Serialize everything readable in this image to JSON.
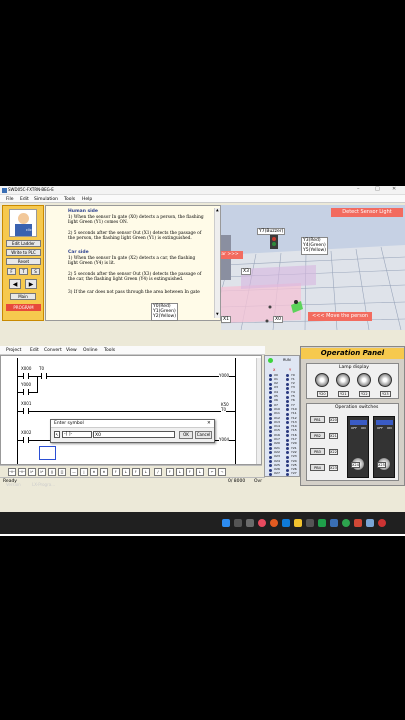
{
  "window": {
    "title": "SWD05C-FXTRN-BEG-E"
  },
  "menu": [
    "File",
    "Edit",
    "Simulation",
    "Tools",
    "Help"
  ],
  "left_panel": {
    "edit_ladder": "Edit Ladder",
    "write_plc": "Write to PLC",
    "reset": "Reset",
    "keys": [
      "F",
      "T",
      "S"
    ],
    "main": "Main",
    "program": "PROGRAM"
  },
  "help": {
    "human_title": "Human side",
    "human_1": "1) When the sensor In gate (X0) detects a person, the flashing light Green (Y1) comes ON.",
    "human_2": "2) 5 seconds after the sensor Out (X1) detects the passage of the person, the flashing light Green (Y1) is extinguished.",
    "car_title": "Car side",
    "car_1": "1) When the sensor In gate (X2) detects a car, the flashing light Green (Y4) is lit.",
    "car_2": "2) 5 seconds after the sensor Out (X3) detects the passage of the car, the flashing light Green (Y4) is extinguished.",
    "car_3": "3) If the car does not pass through the area between In gate"
  },
  "scene": {
    "detect_sensor_light": "Detect Sensor Light",
    "buzzer": "Y7(Buzzer)",
    "car_lights": [
      "Y3(Red)",
      "Y4(Green)",
      "Y5(Yellow)"
    ],
    "person_lights": [
      "Y0(Red)",
      "Y1(Green)",
      "Y2(Yellow)"
    ],
    "nav_button": "ar >>>",
    "x3": "X3",
    "x1": "X1",
    "x0": "X0",
    "move_person": "<<< Move the person"
  },
  "ladder_menu": [
    "Project",
    "Edit",
    "Convert",
    "View",
    "Online",
    "Tools"
  ],
  "ladder": {
    "rungs": [
      {
        "step": "X000",
        "contact": "T0",
        "coil": "Y000"
      },
      {
        "step": "Y000",
        "contact": "",
        "coil": ""
      },
      {
        "step": "X001",
        "contact": "",
        "coil": "K50",
        "coil2": "T0"
      },
      {
        "step": "X002",
        "contact": "",
        "coil": "Y004"
      }
    ]
  },
  "dialog": {
    "title": "Enter symbol",
    "type": "-[ ]-",
    "value": "X0",
    "ok": "OK",
    "cancel": "Cancel"
  },
  "status": {
    "ready": "Ready",
    "steps": "0/ 8000",
    "mode": "Ovr",
    "version": "Version",
    "program": "LX-Progra..."
  },
  "io": {
    "run": "RUN",
    "x_header": "X",
    "y_header": "Y",
    "x_labels": [
      "X0",
      "X1",
      "X2",
      "X3",
      "X4",
      "X5",
      "X6",
      "X7",
      "X10",
      "X11",
      "X12",
      "X13",
      "X14",
      "X15",
      "X16",
      "X17",
      "X20",
      "X21",
      "X22",
      "X23",
      "X24",
      "X25",
      "X26",
      "X27"
    ],
    "y_labels": [
      "Y0",
      "Y1",
      "Y2",
      "Y3",
      "Y4",
      "Y5",
      "Y6",
      "Y7",
      "Y10",
      "Y11",
      "Y12",
      "Y13",
      "Y14",
      "Y15",
      "Y16",
      "Y17",
      "Y20",
      "Y21",
      "Y22",
      "Y23",
      "Y24",
      "Y25",
      "Y26",
      "Y27"
    ]
  },
  "op_panel": {
    "title": "Operation Panel",
    "lamp_display": "Lamp display",
    "lamps": [
      "Y20",
      "Y21",
      "Y22",
      "Y23"
    ],
    "operation_switches": "Operation switches",
    "pb_buttons": [
      "PB1",
      "PB2",
      "PB3",
      "PB4"
    ],
    "pb_inputs": [
      "X20",
      "X21",
      "X22",
      "X23"
    ],
    "sw_labels": [
      "X24",
      "X25"
    ],
    "on_off": [
      "OFF",
      "ON"
    ]
  },
  "colors": {
    "accent_red": "#f26b5f",
    "scene_floor": "#d9dee8",
    "panel_yellow": "#f6c94e"
  }
}
